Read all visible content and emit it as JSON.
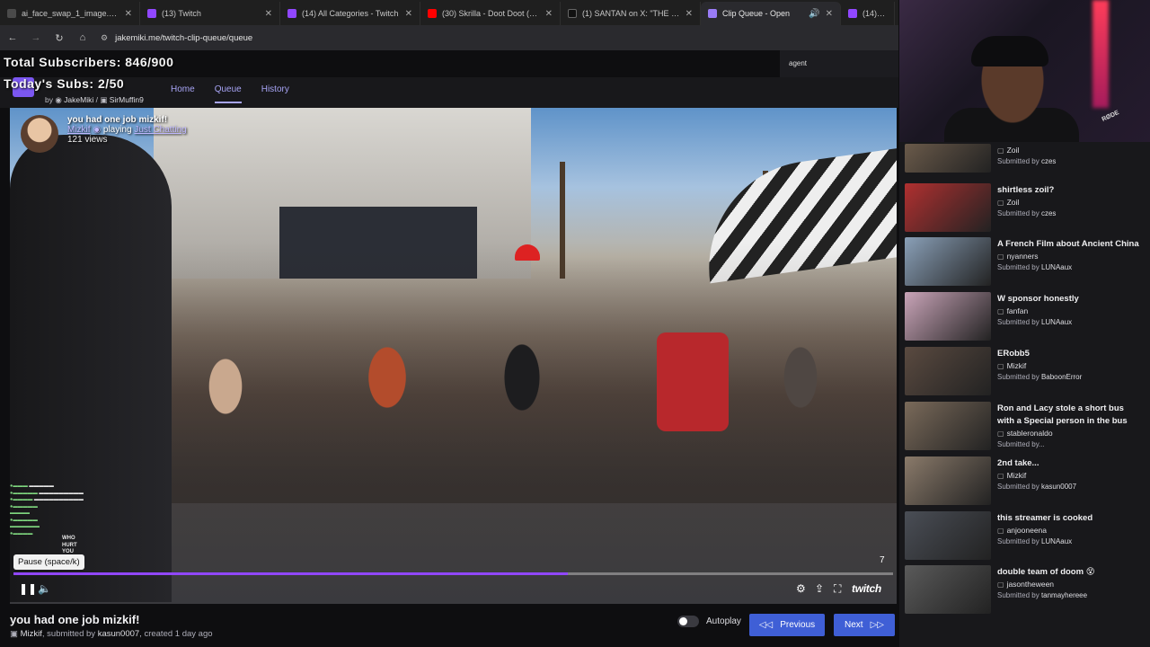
{
  "browser": {
    "tabs": [
      {
        "title": "ai_face_swap_1_image.png (1548",
        "color": "#4a4a4a",
        "active": false
      },
      {
        "title": "(13) Twitch",
        "color": "#9147ff",
        "active": false
      },
      {
        "title": "(14) All Categories - Twitch",
        "color": "#9147ff",
        "active": false
      },
      {
        "title": "(30) Skrilla - Doot Doot (6 7) (O",
        "color": "#ff0000",
        "active": false
      },
      {
        "title": "(1) SANTAN on X: \"THE BOY W",
        "color": "#111111",
        "active": false
      },
      {
        "title": "Clip Queue - Open",
        "color": "#9a7cf7",
        "active": true
      },
      {
        "title": "(14) (a)",
        "color": "#9147ff",
        "active": false
      }
    ],
    "url": "jakemiki.me/twitch-clip-queue/queue"
  },
  "overlay": {
    "total_subs": "Total Subscribers: 846/900",
    "todays_subs": "Today's Subs: 2/50",
    "agent": "agent"
  },
  "site": {
    "byline_prefix": "by",
    "author1": "JakeMiki",
    "author2": "SirMuffin9",
    "nav": [
      {
        "label": "Home",
        "active": false
      },
      {
        "label": "Queue",
        "active": true
      },
      {
        "label": "History",
        "active": false
      }
    ]
  },
  "player": {
    "clip_title": "you had one job mizkif!",
    "channel": "Mizkif",
    "playing_word": "playing",
    "category": "Just Chatting",
    "views": "121 views",
    "tooltip": "Pause (space/k)",
    "time": "7",
    "progress": 0.63,
    "chat_overlay_text": "WHO HURT YOU",
    "brand": "twitch"
  },
  "clip_details": {
    "title": "you had one job mizkif!",
    "channel": "Mizkif",
    "submitted_by_label": ", submitted by",
    "submitter": "kasun0007",
    "created": ", created 1 day ago"
  },
  "controls": {
    "autoplay_label": "Autoplay",
    "prev_label": "Previous",
    "next_label": "Next"
  },
  "queue": {
    "submitted_by_prefix": "Submitted by",
    "items": [
      {
        "title": "",
        "channel": "Zoil",
        "submitter": "czes",
        "thumb": "#6a5a4a"
      },
      {
        "title": "shirtless zoil?",
        "channel": "Zoil",
        "submitter": "czes",
        "thumb": "#b03030"
      },
      {
        "title": "A French Film about Ancient China",
        "channel": "nyanners",
        "submitter": "LUNAaux",
        "thumb": "#8aa0b8"
      },
      {
        "title": "W sponsor honestly",
        "channel": "fanfan",
        "submitter": "LUNAaux",
        "thumb": "#c9a4b8"
      },
      {
        "title": "ERobb5",
        "channel": "Mizkif",
        "submitter": "BaboonError",
        "thumb": "#5a4a40"
      },
      {
        "title": "Ron and Lacy stole a short bus with a Special person in the bus",
        "channel": "stableronaldo",
        "submitter": "Submitted by...",
        "thumb": "#7a6a5a"
      },
      {
        "title": "2nd take...",
        "channel": "Mizkif",
        "submitter": "kasun0007",
        "thumb": "#8a7a6a"
      },
      {
        "title": "this streamer is cooked",
        "channel": "anjooneena",
        "submitter": "LUNAaux",
        "thumb": "#4a4e56"
      },
      {
        "title": "double team of doom 😵",
        "channel": "jasontheween",
        "submitter": "tanmayhereee",
        "thumb": "#5a5a5a"
      }
    ]
  }
}
